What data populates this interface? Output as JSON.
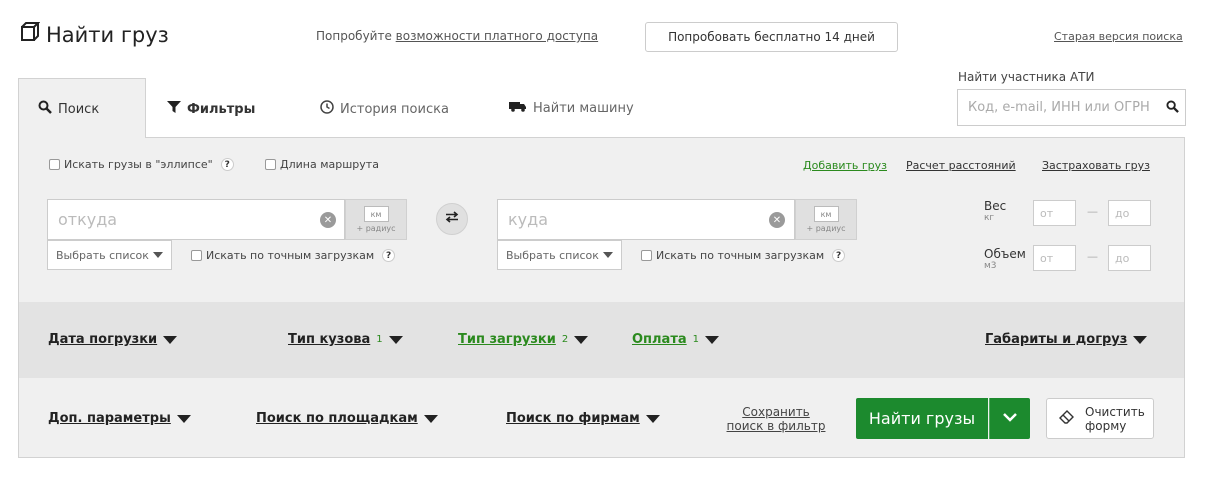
{
  "header": {
    "title": "Найти груз",
    "try_prefix": "Попробуйте ",
    "try_link": "возможности платного доступа",
    "try_button": "Попробовать бесплатно 14 дней",
    "old_version": "Старая версия поиска"
  },
  "tabs": {
    "search": "Поиск",
    "filters": "Фильтры",
    "history": "История поиска",
    "find_truck": "Найти машину"
  },
  "ati": {
    "label": "Найти участника АТИ",
    "placeholder": "Код, e-mail, ИНН или ОГРН"
  },
  "options": {
    "ellipse": "Искать грузы в \"эллипсе\"",
    "route_length": "Длина маршрута",
    "help": "?"
  },
  "links": {
    "add_cargo": "Добавить груз",
    "distance": "Расчет расстояний",
    "insure": "Застраховать груз"
  },
  "from": {
    "placeholder": "откуда",
    "km": "км",
    "radius": "+ радиус",
    "select_list": "Выбрать список",
    "exact": "Искать по точным загрузкам"
  },
  "to": {
    "placeholder": "куда",
    "km": "км",
    "radius": "+ радиус",
    "select_list": "Выбрать список",
    "exact": "Искать по точным загрузкам"
  },
  "weight": {
    "label": "Вес",
    "unit": "кг",
    "from": "от",
    "to": "до"
  },
  "volume": {
    "label": "Объем",
    "unit": "м3",
    "from": "от",
    "to": "до"
  },
  "filters_row1": {
    "load_date": "Дата погрузки",
    "body_type": "Тип кузова",
    "body_count": "1",
    "load_type": "Тип загрузки",
    "load_count": "2",
    "payment": "Оплата",
    "payment_count": "1",
    "dimensions": "Габариты и догруз"
  },
  "filters_row2": {
    "extra": "Доп. параметры",
    "platforms": "Поиск по площадкам",
    "firms": "Поиск по фирмам"
  },
  "actions": {
    "save_line1": "Сохранить",
    "save_line2": "поиск в фильтр",
    "find": "Найти грузы",
    "clear_line1": "Очистить",
    "clear_line2": "форму"
  },
  "colors": {
    "green": "#1c8a2e",
    "link_green": "#2b8a1e"
  }
}
